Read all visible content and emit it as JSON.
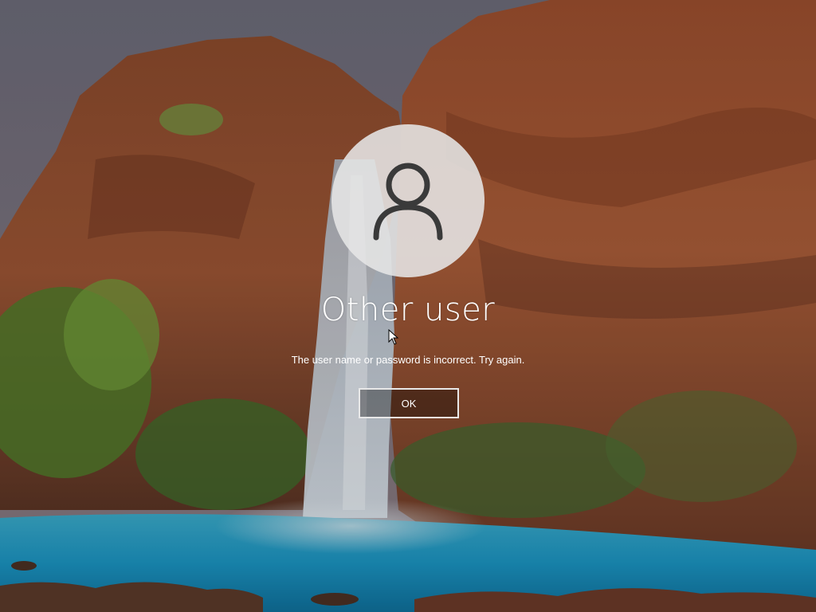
{
  "screen": {
    "type": "lock-screen",
    "background": "waterfall-canyon-wallpaper"
  },
  "login": {
    "avatar_icon": "user-avatar-icon",
    "user_name": "Other user",
    "error_message": "The user name or password is incorrect. Try again.",
    "ok_label": "OK"
  },
  "colors": {
    "text": "#ffffff",
    "avatar_bg": "#e6e6e6",
    "avatar_glyph": "#3a3a3a",
    "button_border": "#e8e8e8"
  }
}
